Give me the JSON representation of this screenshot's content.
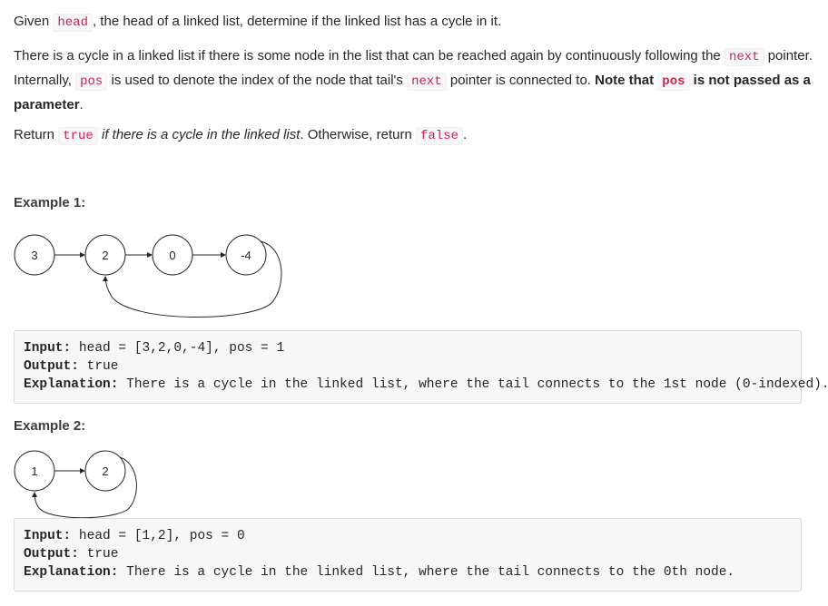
{
  "intro": {
    "given": "Given ",
    "head_code": "head",
    "rest": ", the head of a linked list, determine if the linked list has a cycle in it."
  },
  "cycle_desc": {
    "part1": "There is a cycle in a linked list if there is some node in the list that can be reached again by continuously following the ",
    "next_code": "next",
    "part2": " pointer. Internally, ",
    "pos_code": "pos",
    "part3": " is used to denote the index of the node that tail's ",
    "next_code2": "next",
    "part4": " pointer is connected to. ",
    "bold1": "Note that ",
    "pos_code2": "pos",
    "bold2": " is not passed as a parameter",
    "end": "."
  },
  "return_line": {
    "part1": "Return ",
    "true_code": "true",
    "italic": " if there is a cycle in the linked list",
    "part2": ". Otherwise, return ",
    "false_code": "false",
    "end": "."
  },
  "example1": {
    "title": "Example 1:",
    "nodes": [
      "3",
      "2",
      "0",
      "-4"
    ],
    "input_label": "Input:",
    "input_value": " head = [3,2,0,-4], pos = 1",
    "output_label": "Output:",
    "output_value": " true",
    "explanation_label": "Explanation:",
    "explanation_value": " There is a cycle in the linked list, where the tail connects to the 1st node (0-indexed)."
  },
  "example2": {
    "title": "Example 2:",
    "nodes": [
      "1",
      "2"
    ],
    "input_label": "Input:",
    "input_value": " head = [1,2], pos = 0",
    "output_label": "Output:",
    "output_value": " true",
    "explanation_label": "Explanation:",
    "explanation_value": " There is a cycle in the linked list, where the tail connects to the 0th node."
  }
}
